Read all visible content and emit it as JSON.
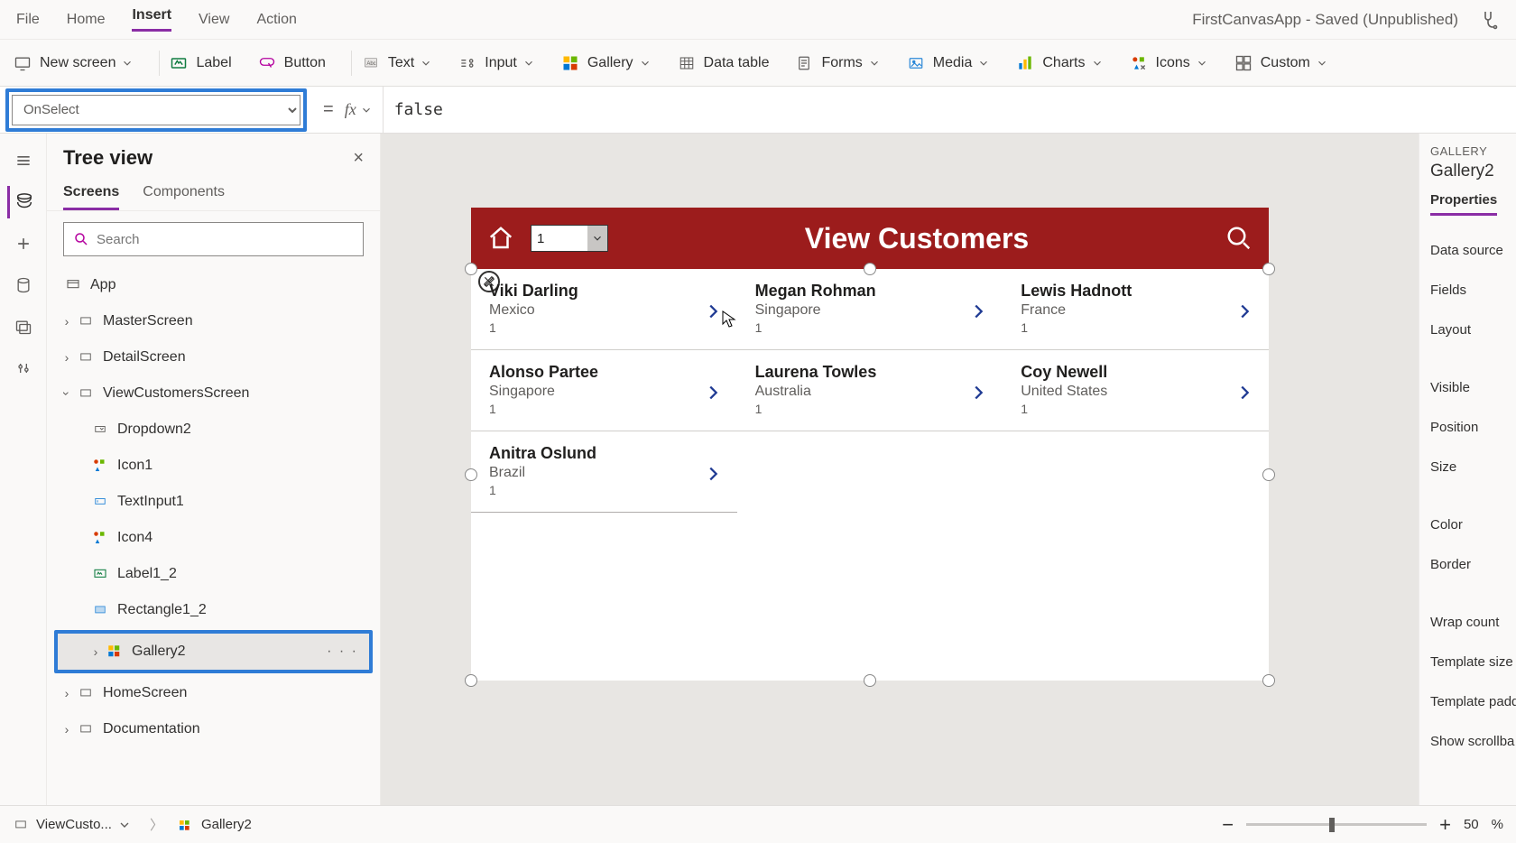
{
  "menu": {
    "file": "File",
    "home": "Home",
    "insert": "Insert",
    "view": "View",
    "action": "Action",
    "appTitle": "FirstCanvasApp - Saved (Unpublished)"
  },
  "ribbon": {
    "newScreen": "New screen",
    "label": "Label",
    "button": "Button",
    "text": "Text",
    "input": "Input",
    "gallery": "Gallery",
    "dataTable": "Data table",
    "forms": "Forms",
    "media": "Media",
    "charts": "Charts",
    "icons": "Icons",
    "custom": "Custom"
  },
  "formulaBar": {
    "property": "OnSelect",
    "value": "false"
  },
  "tree": {
    "title": "Tree view",
    "tabs": {
      "screens": "Screens",
      "components": "Components"
    },
    "searchPlaceholder": "Search",
    "nodes": {
      "app": "App",
      "master": "MasterScreen",
      "detail": "DetailScreen",
      "viewCust": "ViewCustomersScreen",
      "dropdown2": "Dropdown2",
      "icon1": "Icon1",
      "textinput1": "TextInput1",
      "icon4": "Icon4",
      "label12": "Label1_2",
      "rect12": "Rectangle1_2",
      "gallery2": "Gallery2",
      "homeScreen": "HomeScreen",
      "documentation": "Documentation"
    }
  },
  "canvasApp": {
    "headerTitle": "View Customers",
    "dropdownValue": "1",
    "customers": [
      {
        "name": "Viki  Darling",
        "country": "Mexico",
        "num": "1"
      },
      {
        "name": "Megan  Rohman",
        "country": "Singapore",
        "num": "1"
      },
      {
        "name": "Lewis  Hadnott",
        "country": "France",
        "num": "1"
      },
      {
        "name": "Alonso  Partee",
        "country": "Singapore",
        "num": "1"
      },
      {
        "name": "Laurena  Towles",
        "country": "Australia",
        "num": "1"
      },
      {
        "name": "Coy  Newell",
        "country": "United States",
        "num": "1"
      },
      {
        "name": "Anitra  Oslund",
        "country": "Brazil",
        "num": "1"
      }
    ]
  },
  "propPane": {
    "category": "GALLERY",
    "name": "Gallery2",
    "tab": "Properties",
    "rows": [
      "Data source",
      "Fields",
      "Layout",
      "Visible",
      "Position",
      "Size",
      "Color",
      "Border",
      "Wrap count",
      "Template size",
      "Template padd",
      "Show scrollba"
    ]
  },
  "status": {
    "breadcrumb1": "ViewCusto...",
    "breadcrumb2": "Gallery2",
    "zoom": "50",
    "pct": "%"
  }
}
